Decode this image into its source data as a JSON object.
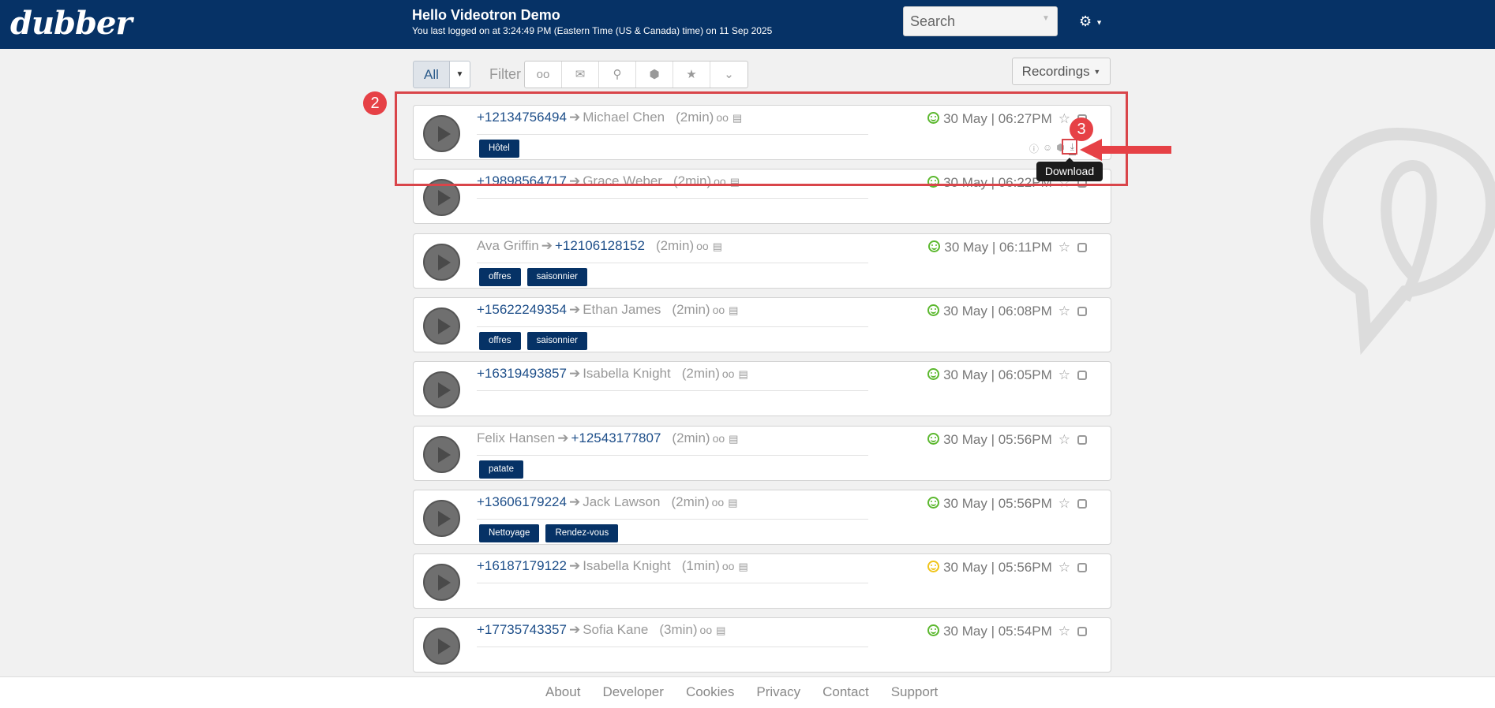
{
  "app": {
    "logo": "dubber",
    "greeting_title": "Hello Videotron Demo",
    "greeting_sub": "You last logged on at 3:24:49 PM (Eastern Time (US & Canada) time) on 11 Sep 2025"
  },
  "search": {
    "placeholder": "Search"
  },
  "toolbar": {
    "all_label": "All",
    "filter_label": "Filter",
    "filter_icons": [
      "voicemail-icon",
      "envelope-icon",
      "map-marker-icon",
      "tag-icon",
      "star-icon",
      "chevron-down-icon"
    ],
    "recordings_label": "Recordings"
  },
  "records": [
    {
      "from": "+12134756494",
      "to": "Michael Chen",
      "from_is_number": true,
      "duration": "(2min)",
      "date": "30 May | 06:27PM",
      "sentiment": "positive",
      "tags": [
        "Hôtel"
      ]
    },
    {
      "from": "+19898564717",
      "to": "Grace Weber",
      "from_is_number": true,
      "duration": "(2min)",
      "date": "30 May | 06:22PM",
      "sentiment": "positive",
      "tags": []
    },
    {
      "from": "Ava Griffin",
      "to": "+12106128152",
      "from_is_number": false,
      "duration": "(2min)",
      "date": "30 May | 06:11PM",
      "sentiment": "positive",
      "tags": [
        "offres",
        "saisonnier"
      ]
    },
    {
      "from": "+15622249354",
      "to": "Ethan James",
      "from_is_number": true,
      "duration": "(2min)",
      "date": "30 May | 06:08PM",
      "sentiment": "positive",
      "tags": [
        "offres",
        "saisonnier"
      ]
    },
    {
      "from": "+16319493857",
      "to": "Isabella Knight",
      "from_is_number": true,
      "duration": "(2min)",
      "date": "30 May | 06:05PM",
      "sentiment": "positive",
      "tags": []
    },
    {
      "from": "Felix Hansen",
      "to": "+12543177807",
      "from_is_number": false,
      "duration": "(2min)",
      "date": "30 May | 05:56PM",
      "sentiment": "positive",
      "tags": [
        "patate"
      ]
    },
    {
      "from": "+13606179224",
      "to": "Jack Lawson",
      "from_is_number": true,
      "duration": "(2min)",
      "date": "30 May | 05:56PM",
      "sentiment": "positive",
      "tags": [
        "Nettoyage",
        "Rendez-vous"
      ]
    },
    {
      "from": "+16187179122",
      "to": "Isabella Knight",
      "from_is_number": true,
      "duration": "(1min)",
      "date": "30 May | 05:56PM",
      "sentiment": "neutral",
      "tags": []
    },
    {
      "from": "+17735743357",
      "to": "Sofia Kane",
      "from_is_number": true,
      "duration": "(3min)",
      "date": "30 May | 05:54PM",
      "sentiment": "positive",
      "tags": []
    }
  ],
  "annotations": {
    "badge_2": "2",
    "badge_3": "3",
    "tooltip": "Download"
  },
  "footer": {
    "links": [
      "About",
      "Developer",
      "Cookies",
      "Privacy",
      "Contact",
      "Support"
    ]
  },
  "colors": {
    "header_bg": "#063266",
    "accent_red": "#e64146",
    "tag_bg": "#063266",
    "sentiment_positive": "#5cb82f",
    "sentiment_neutral": "#f0c419"
  }
}
